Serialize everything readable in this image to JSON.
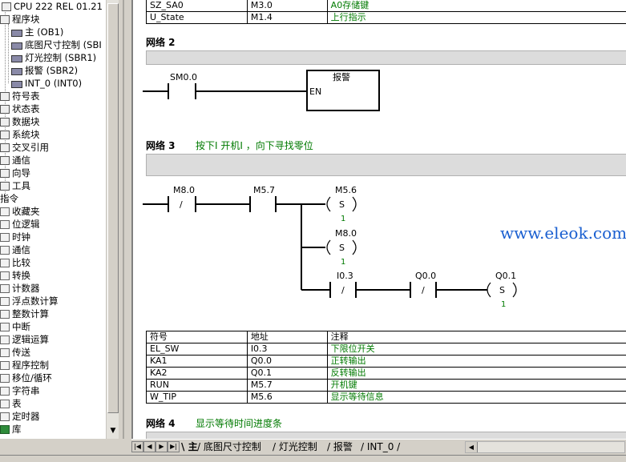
{
  "tree": {
    "cpu": "CPU 222 REL 01.21",
    "program_block": "程序块",
    "blocks": [
      "主 (OB1)",
      "底图尺寸控制 (SBI",
      "灯光控制 (SBR1)",
      "报警 (SBR2)",
      "INT_0 (INT0)"
    ],
    "items": [
      "符号表",
      "状态表",
      "数据块",
      "系统块",
      "交叉引用",
      "通信",
      "向导",
      "工具"
    ],
    "instructions": "指令",
    "instr_items": [
      "收藏夹",
      "位逻辑",
      "时钟",
      "通信",
      "比较",
      "转换",
      "计数器",
      "浮点数计算",
      "整数计算",
      "中断",
      "逻辑运算",
      "传送",
      "程序控制",
      "移位/循环",
      "字符串",
      "表",
      "定时器",
      "库"
    ]
  },
  "top_table": [
    {
      "symbol": "SZ_SA0",
      "address": "M3.0",
      "comment": "A0存储键"
    },
    {
      "symbol": "U_State",
      "address": "M1.4",
      "comment": "上行指示"
    }
  ],
  "network2": {
    "label": "网络 2",
    "contact": "SM0.0",
    "box_title": "报警",
    "box_en": "EN"
  },
  "network3": {
    "label": "网络 3",
    "comment": "按下I  开机I  ，向下寻找零位",
    "c1": "M8.0",
    "c1_op": "/",
    "c2": "M5.7",
    "coil1": "M5.6",
    "coil1_op": "S",
    "coil1_n": "1",
    "coil2": "M8.0",
    "coil2_op": "S",
    "coil2_n": "1",
    "c3": "I0.3",
    "c3_op": "/",
    "c4": "Q0.0",
    "c4_op": "/",
    "coil3": "Q0.1",
    "coil3_op": "S",
    "coil3_n": "1"
  },
  "symbol_table": {
    "headers": [
      "符号",
      "地址",
      "注释"
    ],
    "rows": [
      {
        "symbol": "EL_SW",
        "address": "I0.3",
        "comment": "下限位开关"
      },
      {
        "symbol": "KA1",
        "address": "Q0.0",
        "comment": "正转输出"
      },
      {
        "symbol": "KA2",
        "address": "Q0.1",
        "comment": "反转输出"
      },
      {
        "symbol": "RUN",
        "address": "M5.7",
        "comment": "开机键"
      },
      {
        "symbol": "W_TIP",
        "address": "M5.6",
        "comment": "显示等待信息"
      }
    ]
  },
  "network4": {
    "label": "网络 4",
    "comment": "显示等待时间进度条"
  },
  "watermark": "www.eleok.com",
  "tabs": [
    "主",
    "底图尺寸控制",
    "灯光控制",
    "报警",
    "INT_0"
  ]
}
